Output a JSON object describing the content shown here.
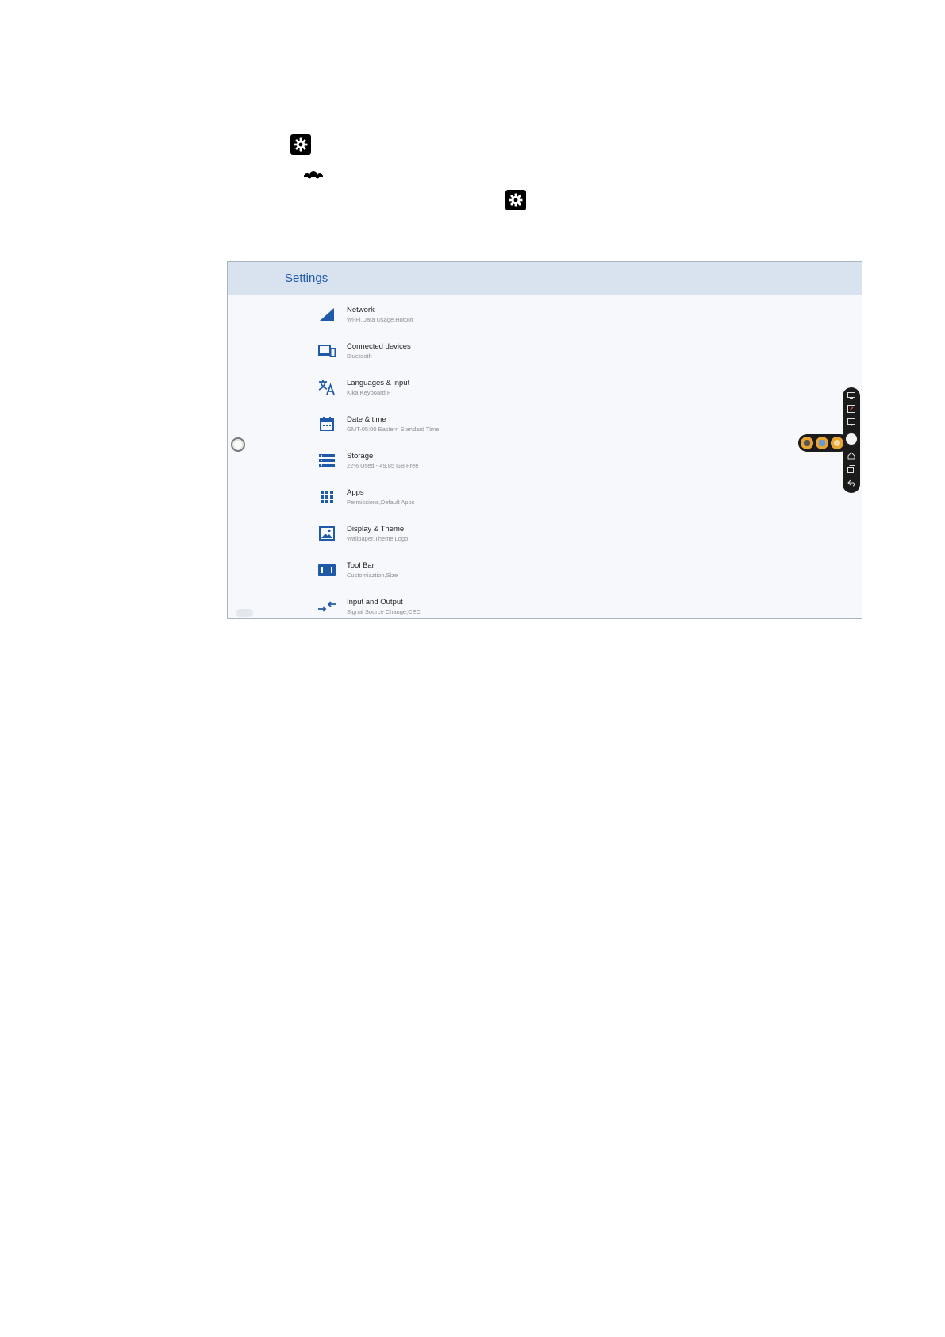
{
  "settings_window": {
    "title": "Settings",
    "items": [
      {
        "title": "Network",
        "subtitle": "Wi-Fi,Data Usage,Hotpot",
        "icon": "network-signal-icon"
      },
      {
        "title": "Connected devices",
        "subtitle": "Bluetooth",
        "icon": "devices-icon"
      },
      {
        "title": "Languages & input",
        "subtitle": "Kika Keyboard F",
        "icon": "translate-icon"
      },
      {
        "title": "Date & time",
        "subtitle": "GMT-05:00 Eastern Standard Time",
        "icon": "calendar-icon"
      },
      {
        "title": "Storage",
        "subtitle": "22% Used - 49.85 GB Free",
        "icon": "storage-icon"
      },
      {
        "title": "Apps",
        "subtitle": "Permissions,Default Apps",
        "icon": "apps-grid-icon"
      },
      {
        "title": "Display & Theme",
        "subtitle": "Wallpaper,Theme,Logo",
        "icon": "display-theme-icon"
      },
      {
        "title": "Tool Bar",
        "subtitle": "Customiaztion,Size",
        "icon": "toolbar-icon"
      },
      {
        "title": "Input and Output",
        "subtitle": "Signal Source Change,CEC",
        "icon": "input-output-icon"
      }
    ]
  },
  "colors": {
    "accent": "#1f5aa8",
    "icon_blue": "#1f5aa8",
    "header_bg": "#d9e2ef",
    "toolbar_bg": "#1b1b1b",
    "toolbar_ext": "#e8a433"
  }
}
